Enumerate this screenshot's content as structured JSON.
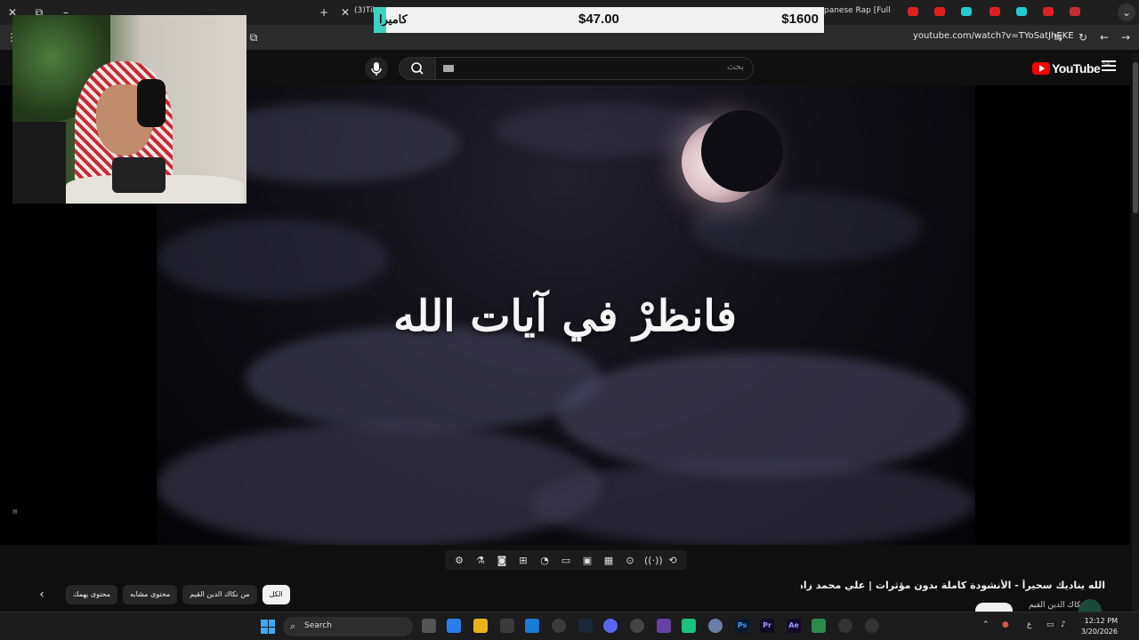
{
  "browser": {
    "tabs": [
      {
        "title": "(3)Tik"
      },
      {
        "title": "panese Rap [Full"
      }
    ],
    "url": "youtube.com/watch?v=TYoSatJhEKE"
  },
  "overlay": {
    "camera_label": "كاميرا",
    "amount_1": "$47.00",
    "amount_2": "$1600"
  },
  "youtube": {
    "logo_text": "YouTube",
    "region": "SA",
    "search_placeholder": "بحث"
  },
  "video": {
    "caption": "فانظرْ في آيات الله",
    "title": "الله يناديك سحيراً - الأنشودة كاملة بدون مؤثرات | علي محمد زاهر إدريس",
    "channel_name": "نكاك الدين القيم"
  },
  "chips": [
    {
      "label": "الكل",
      "active": true
    },
    {
      "label": "من نكاك الدين القيم"
    },
    {
      "label": "محتوى مشابه"
    },
    {
      "label": "محتوى يهمك"
    }
  ],
  "taskbar": {
    "search_label": "Search",
    "time": "12:12 PM",
    "date": "3/20/2026",
    "lang": "ع"
  }
}
